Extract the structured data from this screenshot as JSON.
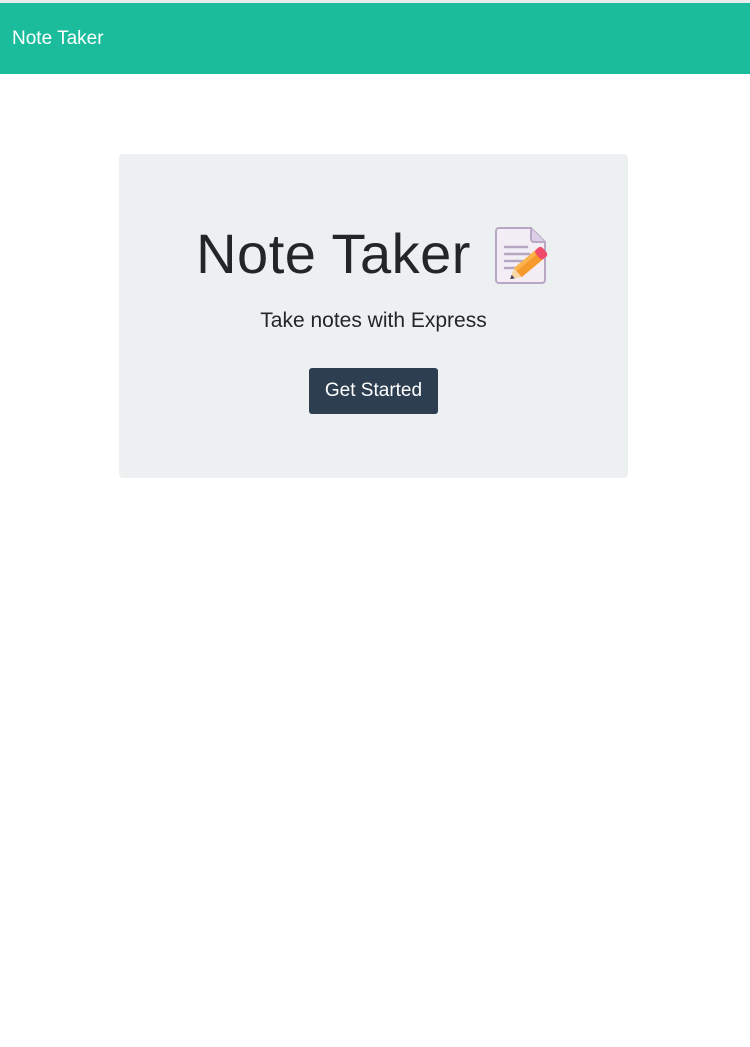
{
  "navbar": {
    "brand": "Note Taker",
    "color": "#1abc9c"
  },
  "hero": {
    "title": "Note Taker",
    "title_icon": "memo-icon",
    "subtitle": "Take notes with Express",
    "button_label": "Get Started",
    "background": "#ecf0f1",
    "button_color": "#2c3e50"
  }
}
